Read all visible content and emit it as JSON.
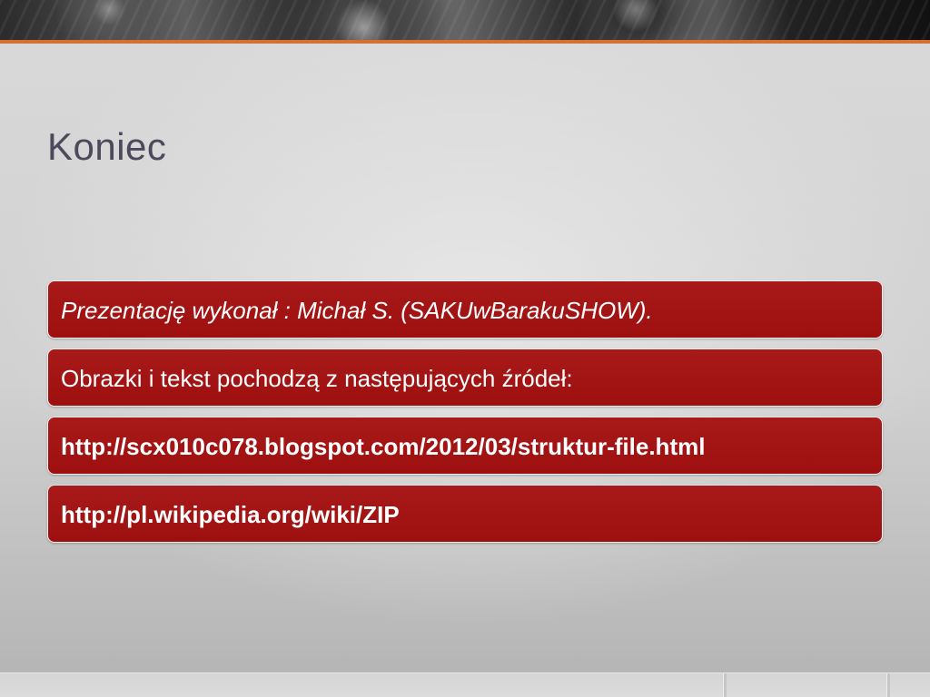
{
  "slide": {
    "title": "Koniec",
    "items": [
      {
        "text": "Prezentację wykonał : Michał S. (SAKUwBarakuSHOW).",
        "style": "italic"
      },
      {
        "text": "Obrazki i tekst pochodzą z następujących źródeł:",
        "style": "normal"
      },
      {
        "text": "http://scx010c078.blogspot.com/2012/03/struktur-file.html",
        "style": "bold"
      },
      {
        "text": "http://pl.wikipedia.org/wiki/ZIP",
        "style": "bold"
      }
    ]
  },
  "colors": {
    "accent": "#d6702e",
    "item_background": "#a3141a",
    "title": "#4a4a5a"
  }
}
